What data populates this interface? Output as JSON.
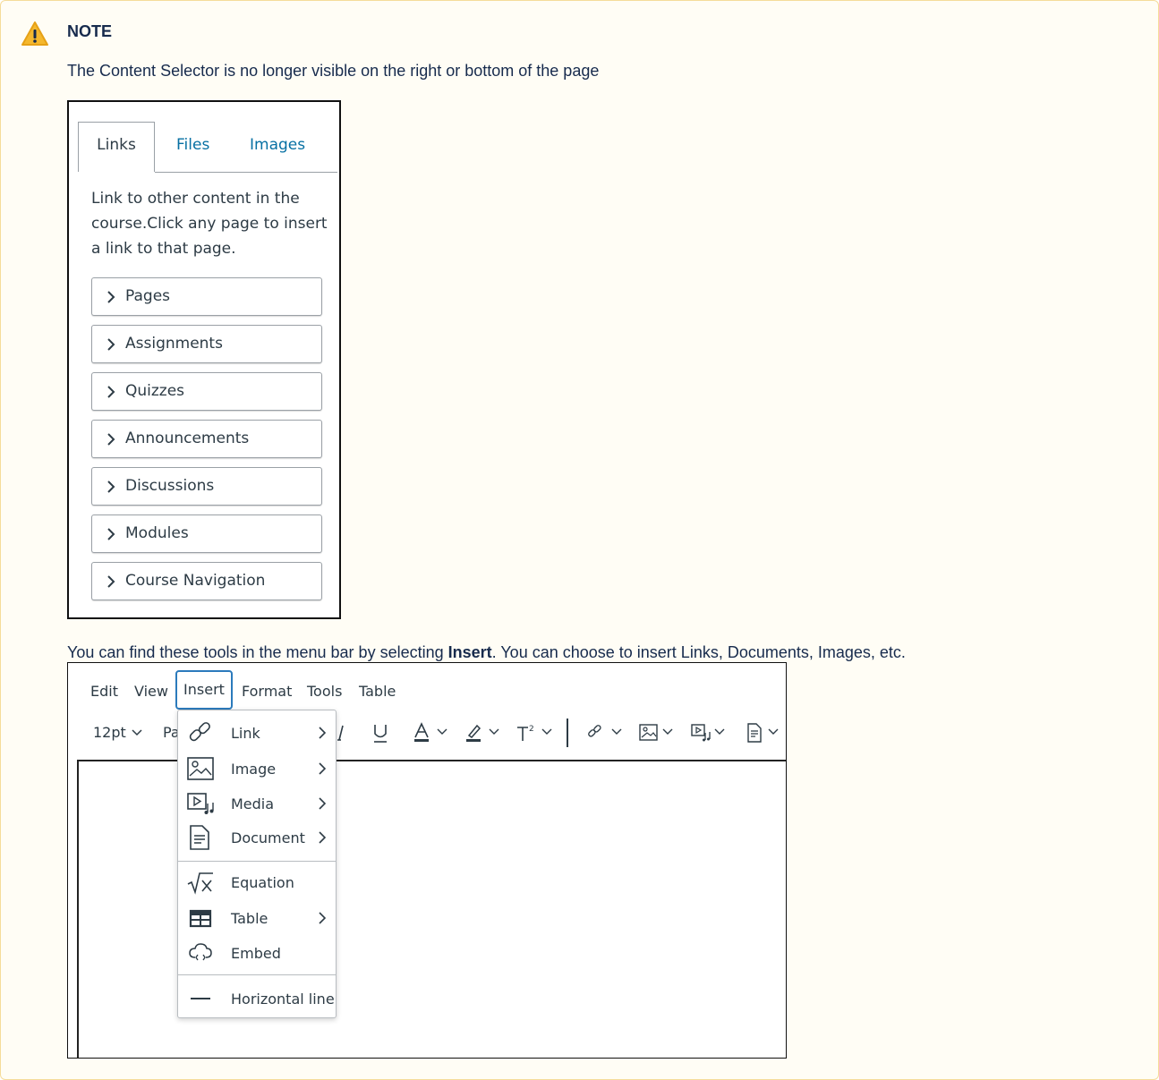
{
  "note": {
    "title": "NOTE",
    "paragraph1": "The Content Selector is no longer visible on the right or bottom of the page",
    "paragraph2_before": "You can find these tools in the menu bar by selecting ",
    "paragraph2_bold": "Insert",
    "paragraph2_after": ". You can choose to insert Links, Documents, Images, etc.",
    "icon": "warning-icon"
  },
  "content_selector": {
    "tabs": [
      "Links",
      "Files",
      "Images"
    ],
    "active_tab": "Links",
    "description": "Link to other content in the course.Click any page to insert a link to that page.",
    "items": [
      "Pages",
      "Assignments",
      "Quizzes",
      "Announcements",
      "Discussions",
      "Modules",
      "Course Navigation"
    ]
  },
  "editor": {
    "menubar": [
      "Edit",
      "View",
      "Insert",
      "Format",
      "Tools",
      "Table"
    ],
    "active_menu": "Insert",
    "toolbar": {
      "font_size": "12pt",
      "paragraph_partial": "Pa"
    },
    "insert_menu": [
      {
        "label": "Link",
        "icon": "link-icon",
        "submenu": true
      },
      {
        "label": "Image",
        "icon": "image-icon",
        "submenu": true
      },
      {
        "label": "Media",
        "icon": "media-icon",
        "submenu": true
      },
      {
        "label": "Document",
        "icon": "document-icon",
        "submenu": true
      },
      {
        "label": "Equation",
        "icon": "equation-icon",
        "submenu": false
      },
      {
        "label": "Table",
        "icon": "table-icon",
        "submenu": true
      },
      {
        "label": "Embed",
        "icon": "embed-icon",
        "submenu": false
      },
      {
        "label": "Horizontal line",
        "icon": "horizontal-line-icon",
        "submenu": false
      }
    ]
  },
  "colors": {
    "note_background": "#fffdf5",
    "note_border": "#f5dc9a",
    "warning_yellow": "#f5b82e",
    "link_blue": "#0770a3",
    "focus_blue": "#2b7abc"
  }
}
